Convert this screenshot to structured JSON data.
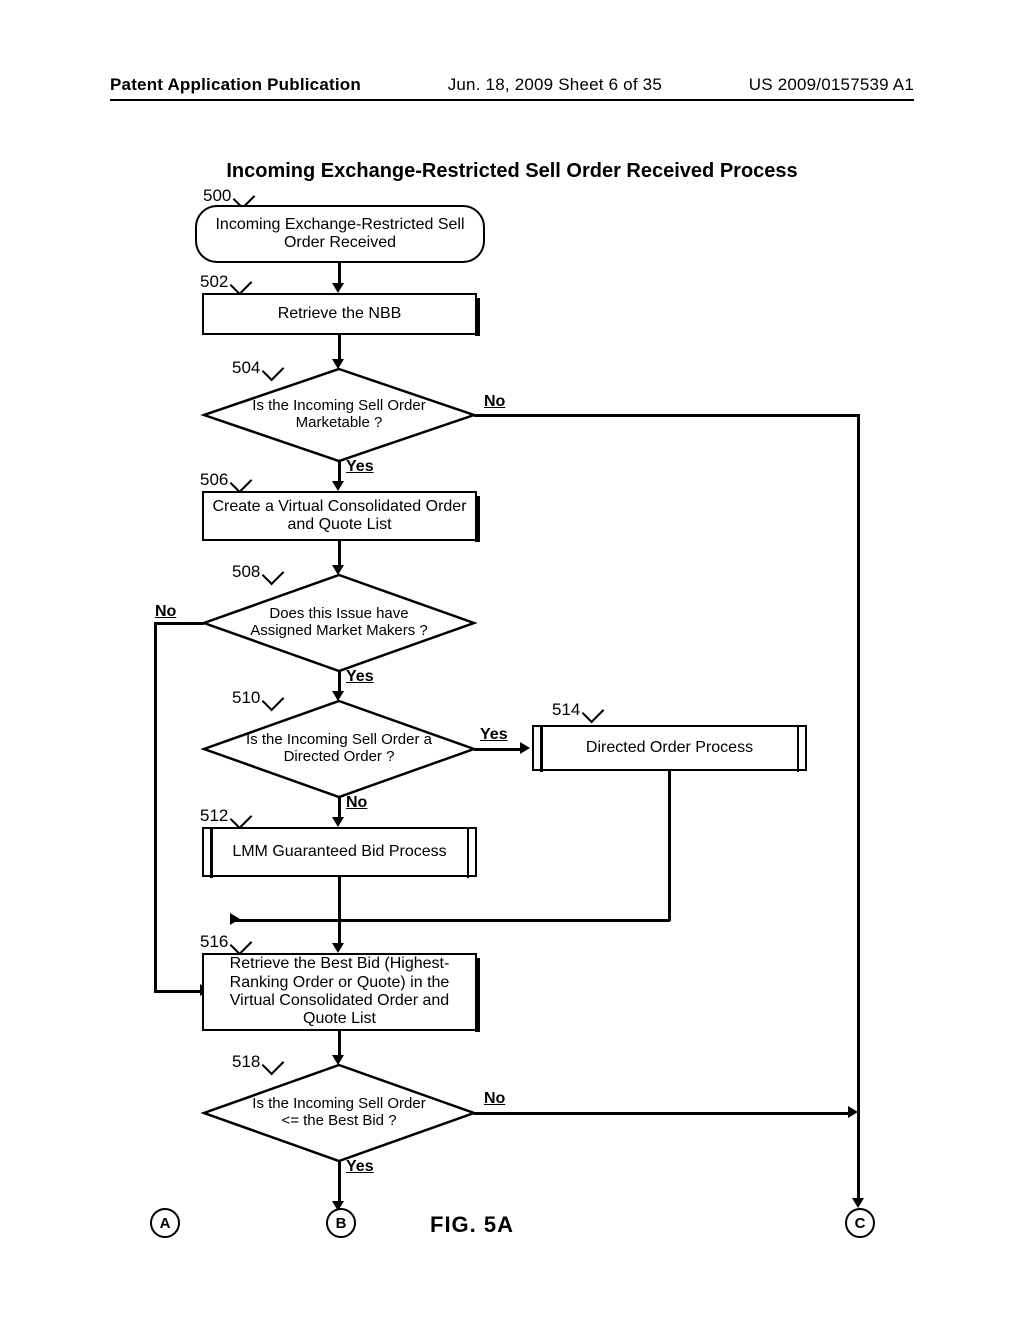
{
  "header": {
    "left": "Patent Application Publication",
    "middle": "Jun. 18, 2009  Sheet 6 of 35",
    "right": "US 2009/0157539 A1"
  },
  "title": "Incoming Exchange-Restricted Sell Order Received Process",
  "refs": {
    "r500": "500",
    "r502": "502",
    "r504": "504",
    "r506": "506",
    "r508": "508",
    "r510": "510",
    "r512": "512",
    "r514": "514",
    "r516": "516",
    "r518": "518"
  },
  "nodes": {
    "start": "Incoming Exchange-Restricted Sell Order Received",
    "n502": "Retrieve the NBB",
    "n504": "Is the Incoming Sell Order Marketable ?",
    "n506": "Create a Virtual Consolidated Order and Quote List",
    "n508": "Does this Issue have Assigned Market Makers ?",
    "n510": "Is the Incoming Sell Order a Directed Order ?",
    "n512": "LMM Guaranteed Bid Process",
    "n514": "Directed Order Process",
    "n516": "Retrieve the Best Bid (Highest-Ranking Order or Quote) in the Virtual Consolidated Order and Quote List",
    "n518": "Is the Incoming Sell Order <= the Best Bid ?"
  },
  "edge_labels": {
    "yes": "Yes",
    "no": "No"
  },
  "connectors": {
    "A": "A",
    "B": "B",
    "C": "C"
  },
  "figure_label": "FIG. 5A"
}
